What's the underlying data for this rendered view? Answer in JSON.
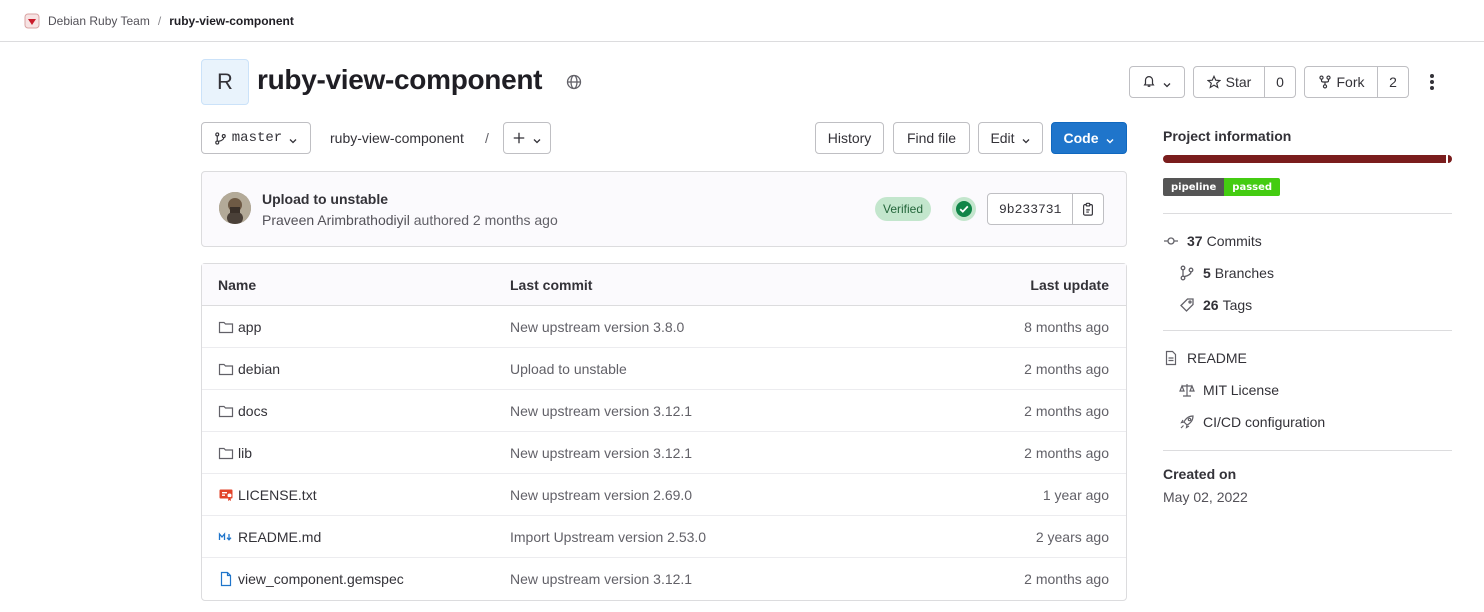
{
  "breadcrumb": {
    "group": "Debian Ruby Team",
    "separator": "/",
    "project": "ruby-view-component"
  },
  "project": {
    "avatar_letter": "R",
    "title": "ruby-view-component",
    "visibility_icon": "globe-icon"
  },
  "header_actions": {
    "notifications_icon": "bell-icon",
    "star_label": "Star",
    "star_count": "0",
    "fork_label": "Fork",
    "fork_count": "2",
    "more_icon": "kebab-icon"
  },
  "repo_toolbar": {
    "branch": "master",
    "path_root": "ruby-view-component",
    "path_sep": "/",
    "add_icon": "plus-icon",
    "history_label": "History",
    "find_file_label": "Find file",
    "edit_label": "Edit",
    "code_label": "Code"
  },
  "last_commit": {
    "title": "Upload to unstable",
    "author": "Praveen Arimbrathodiyil",
    "authored_text": "authored 2 months ago",
    "verified_label": "Verified",
    "pipeline_status": "passed",
    "sha": "9b233731"
  },
  "files": {
    "headers": {
      "name": "Name",
      "last_commit": "Last commit",
      "last_update": "Last update"
    },
    "rows": [
      {
        "icon": "folder-icon",
        "name": "app",
        "commit": "New upstream version 3.8.0",
        "updated": "8 months ago"
      },
      {
        "icon": "folder-icon",
        "name": "debian",
        "commit": "Upload to unstable",
        "updated": "2 months ago"
      },
      {
        "icon": "folder-icon",
        "name": "docs",
        "commit": "New upstream version 3.12.1",
        "updated": "2 months ago"
      },
      {
        "icon": "folder-icon",
        "name": "lib",
        "commit": "New upstream version 3.12.1",
        "updated": "2 months ago"
      },
      {
        "icon": "license-icon",
        "name": "LICENSE.txt",
        "commit": "New upstream version 2.69.0",
        "updated": "1 year ago"
      },
      {
        "icon": "markdown-icon",
        "name": "README.md",
        "commit": "Import Upstream version 2.53.0",
        "updated": "2 years ago"
      },
      {
        "icon": "file-icon",
        "name": "view_component.gemspec",
        "commit": "New upstream version 3.12.1",
        "updated": "2 months ago"
      }
    ]
  },
  "sidebar": {
    "title": "Project information",
    "pipeline_badge": {
      "label": "pipeline",
      "status": "passed"
    },
    "stats": {
      "commits_count": "37",
      "commits_label": "Commits",
      "branches_count": "5",
      "branches_label": "Branches",
      "tags_count": "26",
      "tags_label": "Tags"
    },
    "links": {
      "readme": "README",
      "license": "MIT License",
      "cicd": "CI/CD configuration"
    },
    "created_label": "Created on",
    "created_date": "May 02, 2022"
  },
  "colors": {
    "primary_button": "#1f75cb",
    "language_bar": "#7a1d1d",
    "verified_bg": "#c3e6cd",
    "status_success": "#108548"
  }
}
